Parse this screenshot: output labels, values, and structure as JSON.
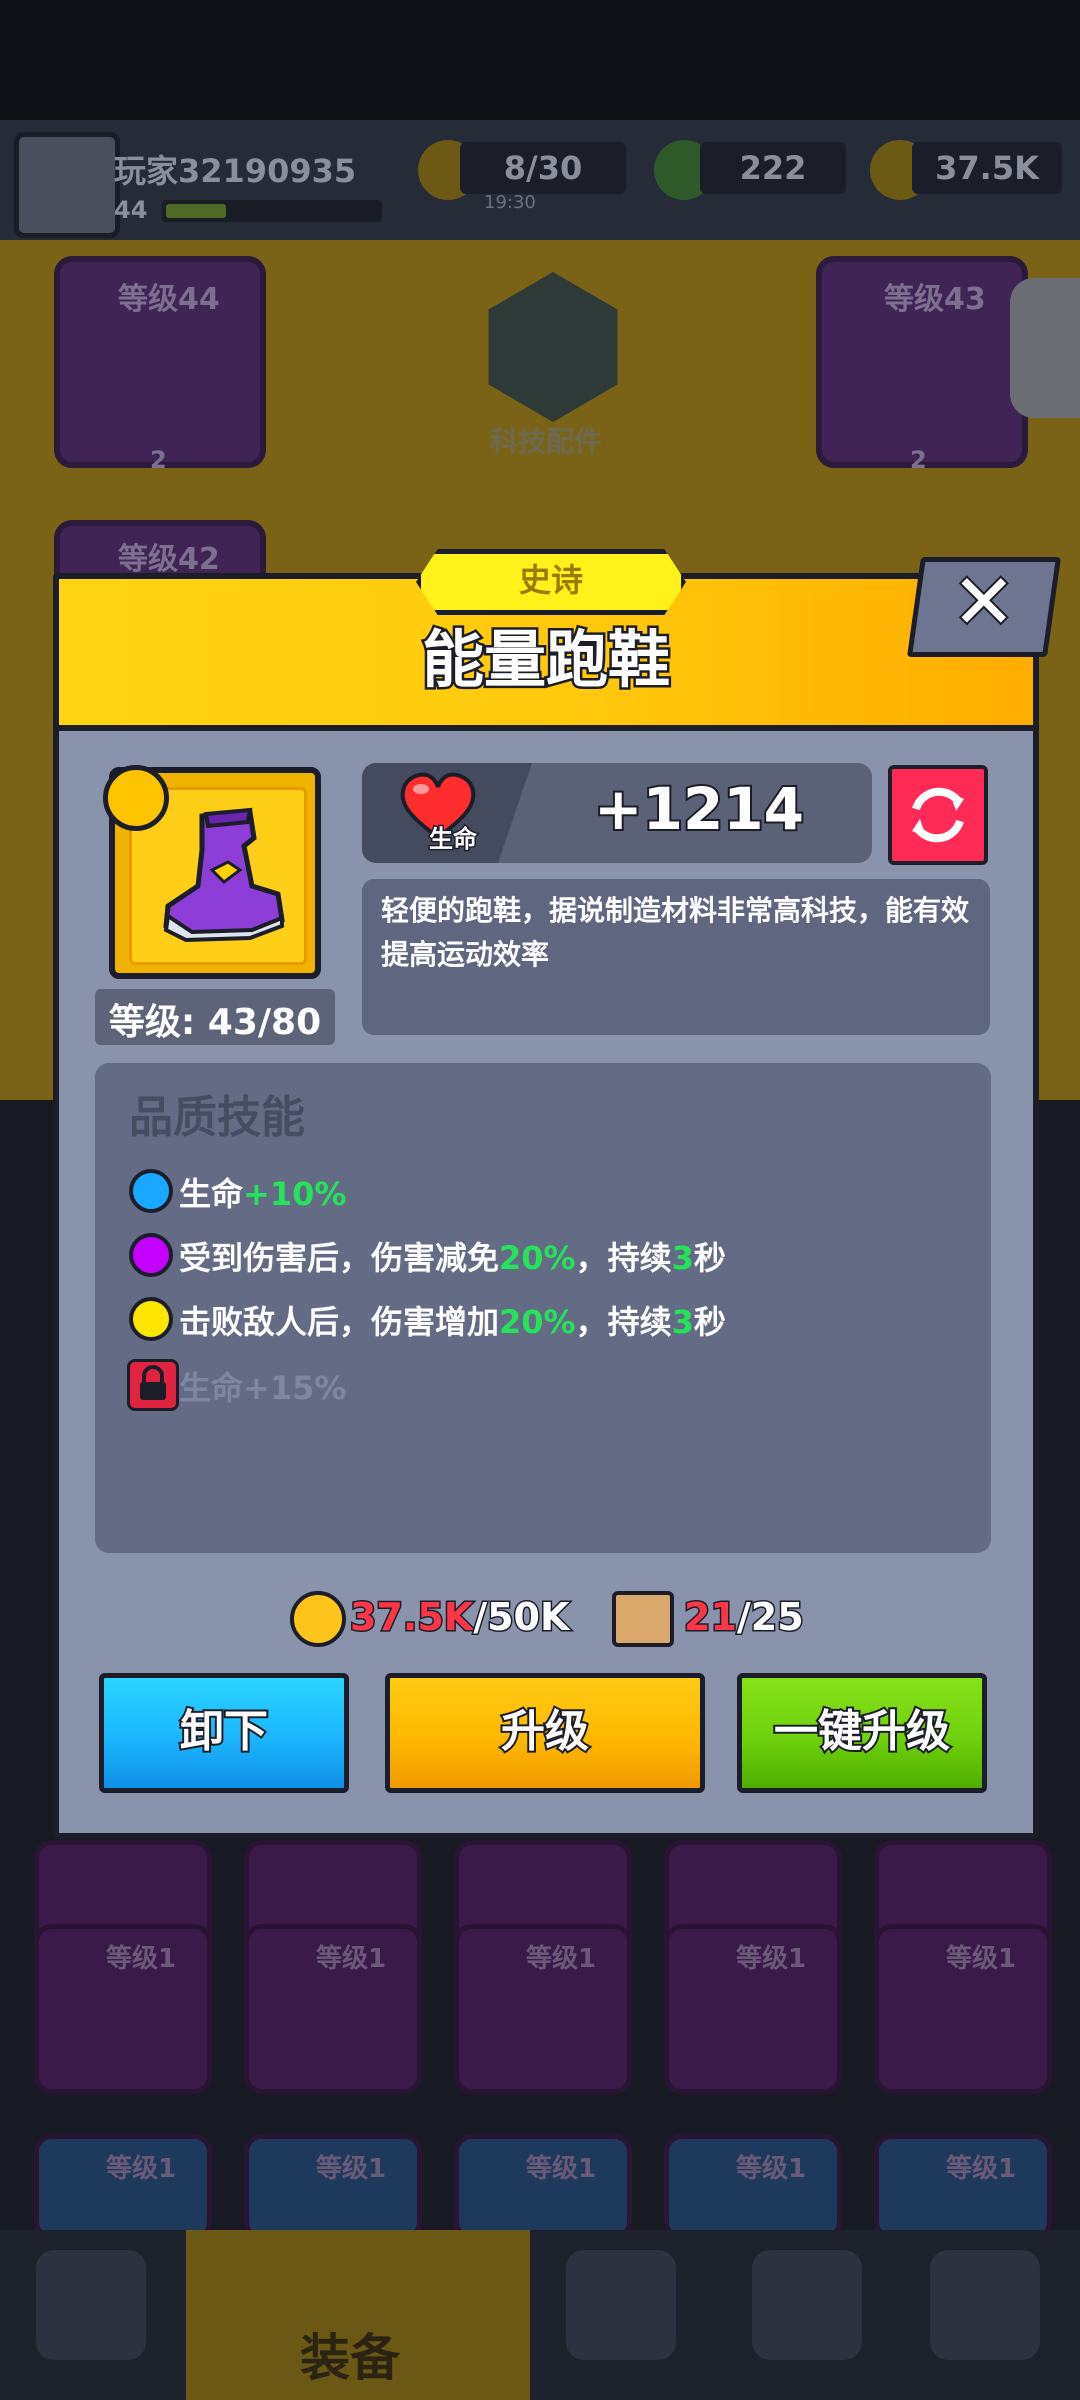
{
  "top_bar": {
    "player_name": "玩家32190935",
    "player_level": "44",
    "energy": "8/30",
    "energy_timer": "19:30",
    "gems": "222",
    "coins": "37.5K"
  },
  "background_slots": {
    "top_left_level": "等级44",
    "top_left_count": "2",
    "top_right_level": "等级43",
    "top_right_count": "2",
    "mid_left_level": "等级42",
    "tech_label": "科技配件",
    "grid_level_label": "等级1"
  },
  "bottom_nav": {
    "equipment_label": "装备"
  },
  "modal": {
    "rarity": "史诗",
    "title": "能量跑鞋",
    "close_symbol": "✕",
    "level_text": "等级: 43/80",
    "stat_label": "生命",
    "stat_value": "+1214",
    "description": "轻便的跑鞋，据说制造材料非常高科技，能有效提高运动效率",
    "skills_title": "品质技能",
    "skills": [
      {
        "prefix": "生命",
        "hl1": "+10%",
        "mid": "",
        "hl2": "",
        "suffix": "",
        "color": "#1aa7ff"
      },
      {
        "prefix": "受到伤害后，伤害减免",
        "hl1": "20%",
        "mid": "，持续",
        "hl2": "3",
        "suffix": "秒",
        "color": "#c400ff"
      },
      {
        "prefix": "击败敌人后，伤害增加",
        "hl1": "20%",
        "mid": "，持续",
        "hl2": "3",
        "suffix": "秒",
        "color": "#ffe600"
      }
    ],
    "locked_skill": "生命+15%",
    "cost": {
      "coins_have": "37.5K",
      "coins_need": "/50K",
      "scrolls_have": "21",
      "scrolls_need": "/25"
    },
    "buttons": {
      "unequip": "卸下",
      "upgrade": "升级",
      "one_click_upgrade": "一键升级"
    }
  }
}
